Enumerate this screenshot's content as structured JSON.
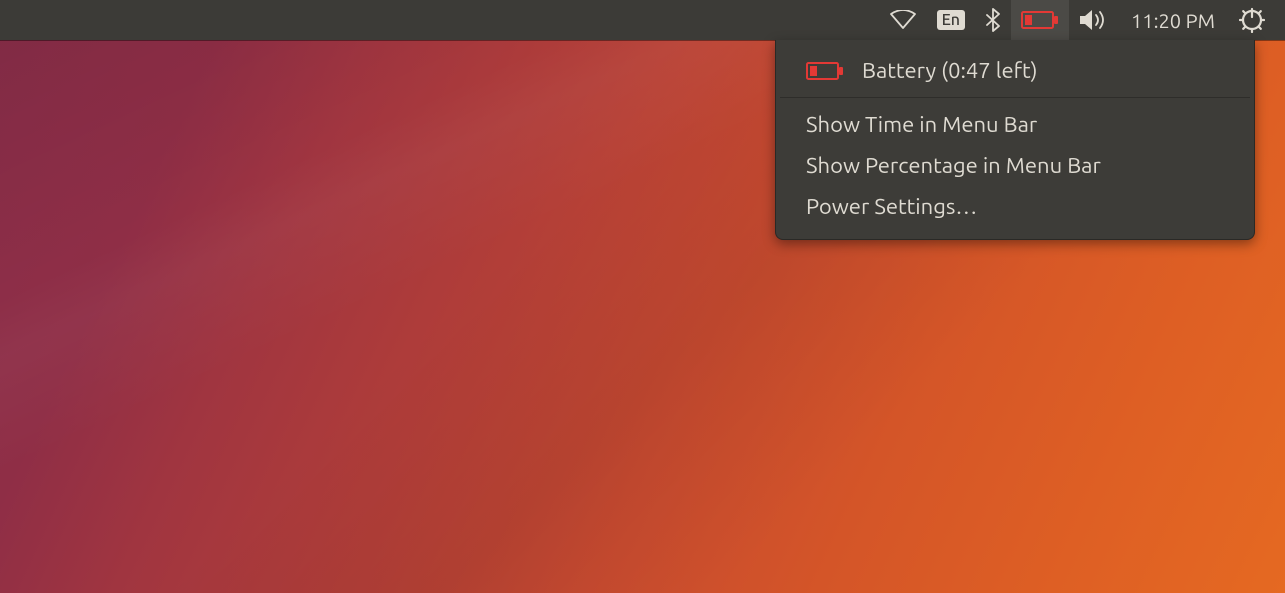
{
  "menubar": {
    "language_indicator": "En",
    "clock": "11:20 PM"
  },
  "dropdown": {
    "battery_status": "Battery (0:47 left)",
    "items": [
      "Show Time in Menu Bar",
      "Show Percentage in Menu Bar",
      "Power Settings…"
    ]
  },
  "colors": {
    "battery_critical": "#e33935",
    "icon": "#dfdbd2"
  }
}
